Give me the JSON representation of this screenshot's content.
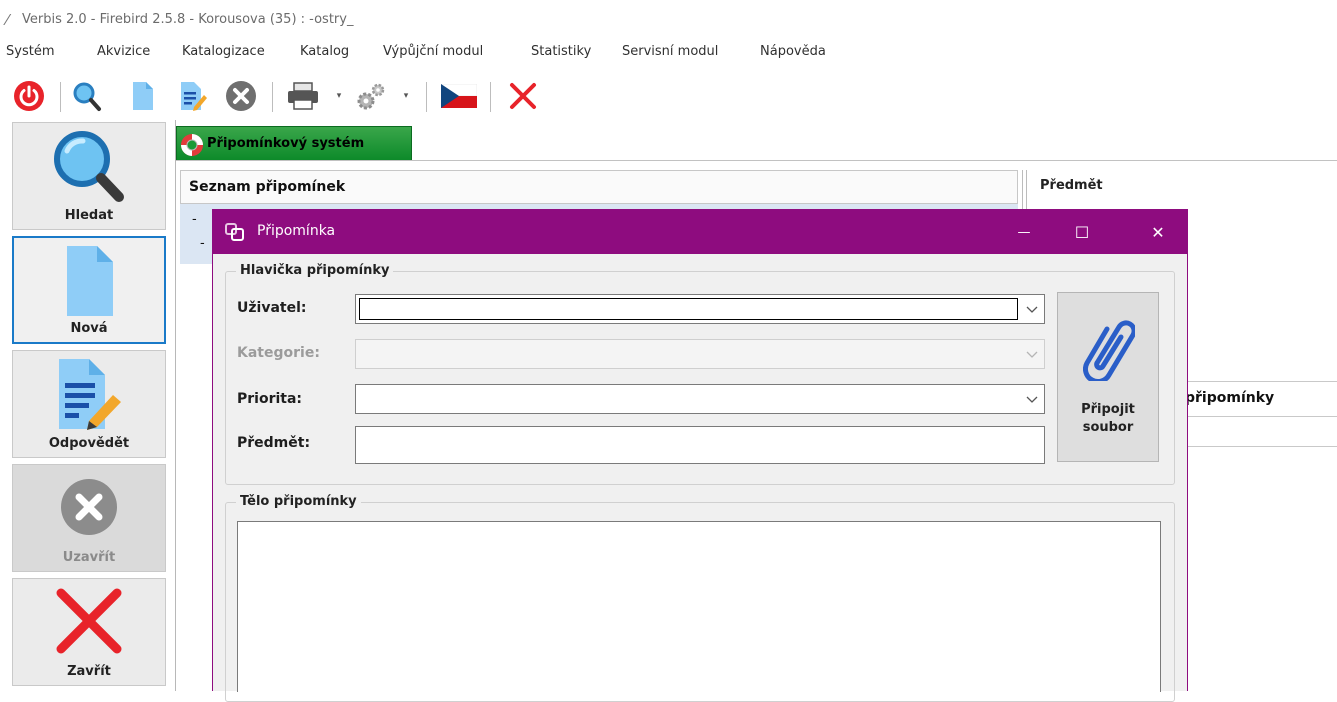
{
  "window": {
    "title": "Verbis 2.0 - Firebird 2.5.8 - Korousova (35) : -ostry_"
  },
  "menu": {
    "items": [
      "Systém",
      "Akvizice",
      "Katalogizace",
      "Katalog",
      "Výpůjční modul",
      "Statistiky",
      "Servisní modul",
      "Nápověda"
    ]
  },
  "toolbar": {
    "buttons": [
      "power-icon",
      "search-icon",
      "new-document-icon",
      "reply-document-icon",
      "close-circle-icon",
      "printer-icon",
      "settings-gears-icon",
      "czech-flag-icon",
      "close-x-icon"
    ]
  },
  "sidebar": {
    "items": [
      {
        "label": "Hledat",
        "icon": "search-icon",
        "state": "normal"
      },
      {
        "label": "Nová",
        "icon": "new-document-icon",
        "state": "active"
      },
      {
        "label": "Odpovědět",
        "icon": "reply-document-icon",
        "state": "normal"
      },
      {
        "label": "Uzavřít",
        "icon": "close-circle-icon",
        "state": "disabled"
      },
      {
        "label": "Zavřít",
        "icon": "close-x-icon",
        "state": "normal"
      }
    ]
  },
  "tab": {
    "label": "Připomínkový systém",
    "icon": "lifebuoy-icon"
  },
  "list": {
    "header": "Seznam připomínek",
    "row_markers": [
      "-",
      "-"
    ]
  },
  "detail": {
    "subject_header": "Předmět",
    "body_header": "připomínky"
  },
  "dialog": {
    "title": "Připomínka",
    "controls": {
      "minimize": "—",
      "maximize": "☐",
      "close": "✕"
    },
    "header_group": {
      "title": "Hlavička připomínky",
      "user_label": "Uživatel:",
      "user_value": "",
      "category_label": "Kategorie:",
      "category_value": "",
      "priority_label": "Priorita:",
      "priority_value": "",
      "subject_label": "Předmět:",
      "subject_value": ""
    },
    "attach_button": {
      "label": "Připojit\nsoubor",
      "icon": "paperclip-icon"
    },
    "body_group": {
      "title": "Tělo připomínky",
      "value": ""
    }
  },
  "colors": {
    "dialog_title_bg": "#8e0c7f",
    "tab_bg": "#1a9a37",
    "sidebar_active_border": "#1a7ac8",
    "list_selection_bg": "#dbe6f3"
  }
}
